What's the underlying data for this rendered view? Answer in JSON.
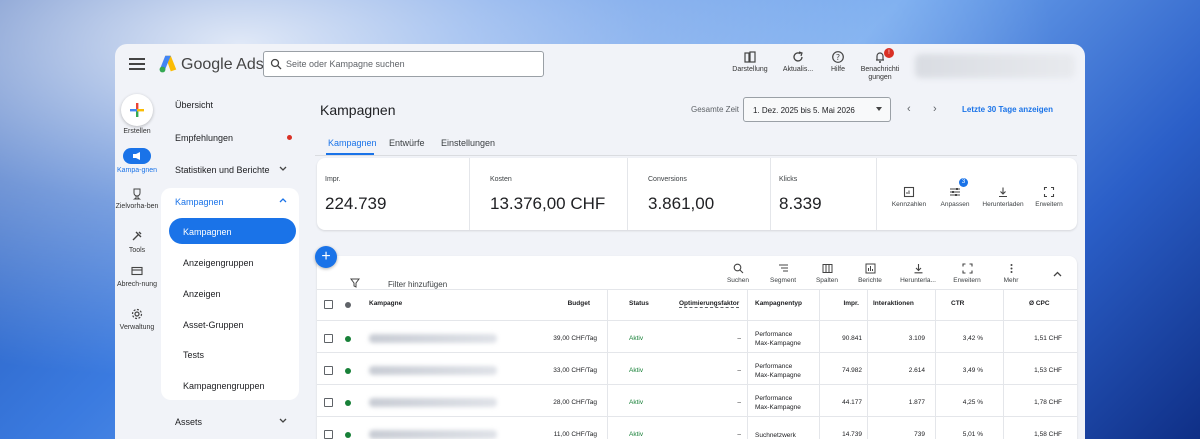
{
  "header": {
    "brand": "Google Ads",
    "search_placeholder": "Seite oder Kampagne suchen",
    "tools": [
      {
        "label": "Darstellung",
        "icon": "appearance-icon"
      },
      {
        "label": "Aktualis...",
        "icon": "refresh-icon"
      },
      {
        "label": "Hilfe",
        "icon": "help-icon"
      },
      {
        "label": "Benachrichti gungen",
        "icon": "bell-icon",
        "badge": "!"
      }
    ]
  },
  "rail": {
    "create_label": "Erstellen",
    "items": [
      {
        "label": "Kampa-gnen",
        "icon": "megaphone-icon"
      },
      {
        "label": "Zielvorha-ben",
        "icon": "trophy-icon"
      },
      {
        "label": "Tools",
        "icon": "tools-icon"
      },
      {
        "label": "Abrech-nung",
        "icon": "billing-icon"
      },
      {
        "label": "Verwaltung",
        "icon": "gear-icon"
      }
    ]
  },
  "nav": {
    "overview": "Übersicht",
    "recommendations": "Empfehlungen",
    "stats": "Statistiken und Berichte",
    "campaigns_group": "Kampagnen",
    "sub_items": [
      "Kampagnen",
      "Anzeigengruppen",
      "Anzeigen",
      "Asset-Gruppen",
      "Tests",
      "Kampagnengruppen"
    ],
    "assets": "Assets"
  },
  "main": {
    "title": "Kampagnen",
    "date_label": "Gesamte Zeit",
    "date_range": "1. Dez. 2025 bis 5. Mai 2026",
    "last30": "Letzte 30 Tage anzeigen",
    "tabs": [
      "Kampagnen",
      "Entwürfe",
      "Einstellungen"
    ]
  },
  "metrics": [
    {
      "label": "Impr.",
      "value": "224.739"
    },
    {
      "label": "Kosten",
      "value": "13.376,00 CHF"
    },
    {
      "label": "Conversions",
      "value": "3.861,00"
    },
    {
      "label": "Klicks",
      "value": "8.339"
    }
  ],
  "metric_tools": [
    {
      "label": "Kennzahlen",
      "icon": "add-chart-icon"
    },
    {
      "label": "Anpassen",
      "icon": "tune-icon",
      "badge": "3"
    },
    {
      "label": "Herunterladen",
      "icon": "download-icon"
    },
    {
      "label": "Erweitern",
      "icon": "expand-icon"
    }
  ],
  "table": {
    "filter_text": "Filter hinzufügen",
    "tools": [
      {
        "label": "Suchen",
        "icon": "search-icon"
      },
      {
        "label": "Segment",
        "icon": "segment-icon"
      },
      {
        "label": "Spalten",
        "icon": "columns-icon"
      },
      {
        "label": "Berichte",
        "icon": "reports-icon"
      },
      {
        "label": "Herunterla...",
        "icon": "download-icon"
      },
      {
        "label": "Erweitern",
        "icon": "expand-icon"
      },
      {
        "label": "Mehr",
        "icon": "more-icon"
      }
    ],
    "headers": [
      "Kampagne",
      "Budget",
      "Status",
      "Optimierungsfaktor",
      "Kampagnentyp",
      "Impr.",
      "Interaktionen",
      "CTR",
      "Ø CPC"
    ],
    "rows": [
      {
        "budget": "39,00 CHF/Tag",
        "status": "Aktiv",
        "opt": "–",
        "type1": "Performance",
        "type2": "Max-Kampagne",
        "impr": "90.841",
        "inter": "3.109",
        "ctr": "3,42 %",
        "cpc": "1,51 CHF"
      },
      {
        "budget": "33,00 CHF/Tag",
        "status": "Aktiv",
        "opt": "–",
        "type1": "Performance",
        "type2": "Max-Kampagne",
        "impr": "74.982",
        "inter": "2.614",
        "ctr": "3,49 %",
        "cpc": "1,53 CHF"
      },
      {
        "budget": "28,00 CHF/Tag",
        "status": "Aktiv",
        "opt": "–",
        "type1": "Performance",
        "type2": "Max-Kampagne",
        "impr": "44.177",
        "inter": "1.877",
        "ctr": "4,25 %",
        "cpc": "1,78 CHF"
      },
      {
        "budget": "11,00 CHF/Tag",
        "status": "Aktiv",
        "opt": "–",
        "type1": "Suchnetzwerk",
        "type2": "",
        "impr": "14.739",
        "inter": "739",
        "ctr": "5,01 %",
        "cpc": "1,58 CHF"
      }
    ]
  },
  "colors": {
    "accent": "#1a73e8",
    "active_green": "#188038",
    "alert_red": "#d93025"
  }
}
